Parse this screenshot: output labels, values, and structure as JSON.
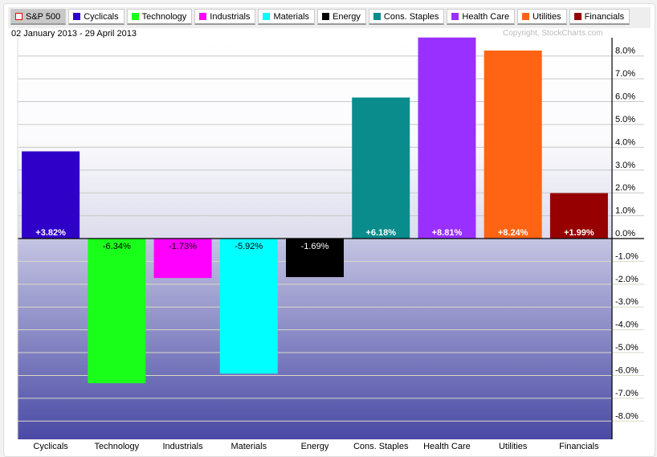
{
  "legend": [
    {
      "label": "S&P 500",
      "color": "#ffffff",
      "selected": true
    },
    {
      "label": "Cyclicals",
      "color": "#2f00c8"
    },
    {
      "label": "Technology",
      "color": "#19ff19"
    },
    {
      "label": "Industrials",
      "color": "#ff00ff"
    },
    {
      "label": "Materials",
      "color": "#00ffff"
    },
    {
      "label": "Energy",
      "color": "#000000"
    },
    {
      "label": "Cons. Staples",
      "color": "#0a8c8c"
    },
    {
      "label": "Health Care",
      "color": "#9a30ff"
    },
    {
      "label": "Utilities",
      "color": "#ff6414"
    },
    {
      "label": "Financials",
      "color": "#960000"
    }
  ],
  "date_range": "02 January 2013 - 29 April 2013",
  "copyright": "Copyright, StockCharts.com",
  "chart_data": {
    "type": "bar",
    "categories": [
      "Cyclicals",
      "Technology",
      "Industrials",
      "Materials",
      "Energy",
      "Cons. Staples",
      "Health Care",
      "Utilities",
      "Financials"
    ],
    "values": [
      3.82,
      -6.34,
      -1.73,
      -5.92,
      -1.69,
      6.18,
      8.81,
      8.24,
      1.99
    ],
    "data_labels": [
      "+3.82%",
      "-6.34%",
      "-1.73%",
      "-5.92%",
      "-1.69%",
      "+6.18%",
      "+8.81%",
      "+8.24%",
      "+1.99%"
    ],
    "colors": [
      "#2f00c8",
      "#19ff19",
      "#ff00ff",
      "#00ffff",
      "#000000",
      "#0a8c8c",
      "#9a30ff",
      "#ff6414",
      "#960000"
    ],
    "label_colors": [
      "#ffffff",
      "#000000",
      "#000000",
      "#000000",
      "#ffffff",
      "#ffffff",
      "#ffffff",
      "#ffffff",
      "#ffffff"
    ],
    "ylim": [
      -8.8,
      8.8
    ],
    "yticks": [
      8,
      7,
      6,
      5,
      4,
      3,
      2,
      1,
      0,
      -1,
      -2,
      -3,
      -4,
      -5,
      -6,
      -7,
      -8
    ],
    "ytick_labels": [
      "8.0%",
      "7.0%",
      "6.0%",
      "5.0%",
      "4.0%",
      "3.0%",
      "2.0%",
      "1.0%",
      "0.0%",
      "-1.0%",
      "-2.0%",
      "-3.0%",
      "-4.0%",
      "-5.0%",
      "-6.0%",
      "-7.0%",
      "-8.0%"
    ],
    "y_axis_side": "right",
    "grid": true
  }
}
